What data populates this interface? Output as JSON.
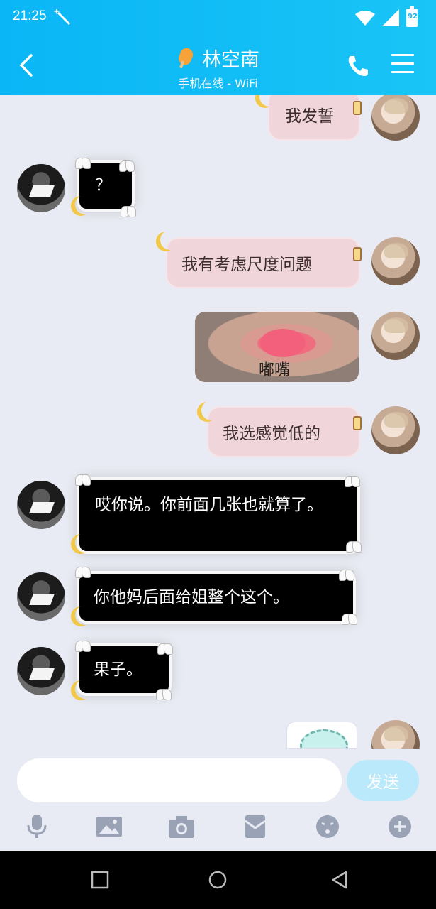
{
  "status_bar": {
    "time": "21:25",
    "battery": "92"
  },
  "header": {
    "title": "林空南",
    "subtitle": "手机在线 - WiFi"
  },
  "messages": [
    {
      "side": "me",
      "type": "text",
      "text": "我发誓"
    },
    {
      "side": "her",
      "type": "text",
      "text": "？"
    },
    {
      "side": "me",
      "type": "text",
      "text": "我有考虑尺度问题"
    },
    {
      "side": "me",
      "type": "image",
      "caption": "嘟嘴"
    },
    {
      "side": "me",
      "type": "text",
      "text": "我选感觉低的"
    },
    {
      "side": "her",
      "type": "text",
      "text": "哎你说。你前面几张也就算了。"
    },
    {
      "side": "her",
      "type": "text",
      "text": "你他妈后面给姐整个这个。"
    },
    {
      "side": "her",
      "type": "text",
      "text": "果子。"
    },
    {
      "side": "me",
      "type": "sticker"
    }
  ],
  "input": {
    "placeholder": "",
    "send_label": "发送"
  },
  "toolbar_icons": [
    "microphone-icon",
    "image-icon",
    "camera-icon",
    "red-packet-icon",
    "emoji-icon",
    "plus-icon"
  ],
  "colors": {
    "header": "#12BDF5",
    "pink_bubble": "#F0D6DA",
    "send_button": "#B9E9FB",
    "background": "#E8EBF3"
  }
}
